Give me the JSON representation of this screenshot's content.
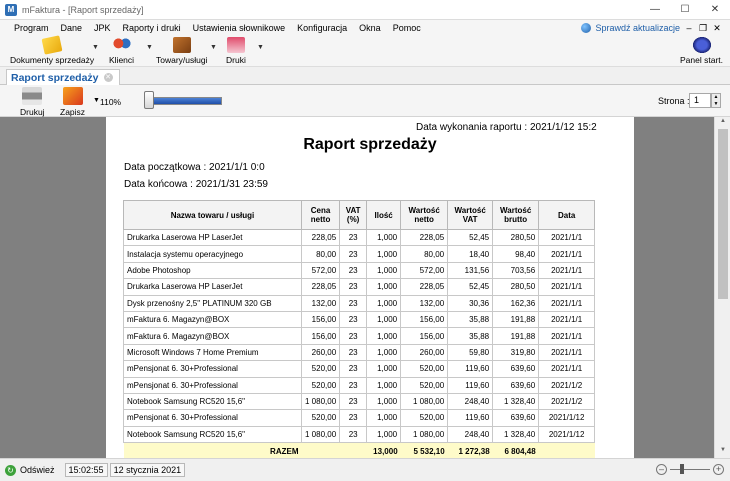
{
  "window": {
    "title": "mFaktura - [Raport sprzedaży]",
    "app_icon": "mfaktura-app-icon"
  },
  "menu": {
    "items": [
      "Program",
      "Dane",
      "JPK",
      "Raporty i druki",
      "Ustawienia słownikowe",
      "Konfiguracja",
      "Okna",
      "Pomoc"
    ],
    "update_link": "Sprawdź aktualizacje"
  },
  "toolbar": {
    "documents": "Dokumenty sprzedaży",
    "clients": "Klienci",
    "goods": "Towary/usługi",
    "prints": "Druki",
    "panel": "Panel start."
  },
  "tab": {
    "label": "Raport sprzedaży"
  },
  "report_toolbar": {
    "print": "Drukuj",
    "save": "Zapisz",
    "zoom": "110%",
    "page_label": "Strona :",
    "page_value": "1"
  },
  "report": {
    "generated": "Data wykonania raportu : 2021/1/12 15:2",
    "title": "Raport sprzedaży",
    "start_date": "Data początkowa : 2021/1/1 0:0",
    "end_date": "Data końcowa : 2021/1/31 23:59",
    "headers": [
      [
        "Nazwa towaru / usługi"
      ],
      [
        "Cena",
        "netto"
      ],
      [
        "VAT",
        "(%)"
      ],
      [
        "Ilość"
      ],
      [
        "Wartość",
        "netto"
      ],
      [
        "Wartość",
        "VAT"
      ],
      [
        "Wartość",
        "brutto"
      ],
      [
        "Data"
      ]
    ],
    "rows": [
      [
        "Drukarka Laserowa HP LaserJet",
        "228,05",
        "23",
        "1,000",
        "228,05",
        "52,45",
        "280,50",
        "2021/1/1"
      ],
      [
        "Instalacja systemu operacyjnego",
        "80,00",
        "23",
        "1,000",
        "80,00",
        "18,40",
        "98,40",
        "2021/1/1"
      ],
      [
        "Adobe Photoshop",
        "572,00",
        "23",
        "1,000",
        "572,00",
        "131,56",
        "703,56",
        "2021/1/1"
      ],
      [
        "Drukarka Laserowa HP LaserJet",
        "228,05",
        "23",
        "1,000",
        "228,05",
        "52,45",
        "280,50",
        "2021/1/1"
      ],
      [
        "Dysk przenośny 2,5\" PLATINUM 320 GB",
        "132,00",
        "23",
        "1,000",
        "132,00",
        "30,36",
        "162,36",
        "2021/1/1"
      ],
      [
        "mFaktura 6. Magazyn@BOX",
        "156,00",
        "23",
        "1,000",
        "156,00",
        "35,88",
        "191,88",
        "2021/1/1"
      ],
      [
        "mFaktura 6. Magazyn@BOX",
        "156,00",
        "23",
        "1,000",
        "156,00",
        "35,88",
        "191,88",
        "2021/1/1"
      ],
      [
        "Microsoft Windows 7 Home Premium",
        "260,00",
        "23",
        "1,000",
        "260,00",
        "59,80",
        "319,80",
        "2021/1/1"
      ],
      [
        "mPensjonat 6. 30+Professional",
        "520,00",
        "23",
        "1,000",
        "520,00",
        "119,60",
        "639,60",
        "2021/1/1"
      ],
      [
        "mPensjonat 6. 30+Professional",
        "520,00",
        "23",
        "1,000",
        "520,00",
        "119,60",
        "639,60",
        "2021/1/2"
      ],
      [
        "Notebook Samsung RC520 15,6\"",
        "1 080,00",
        "23",
        "1,000",
        "1 080,00",
        "248,40",
        "1 328,40",
        "2021/1/2"
      ],
      [
        "mPensjonat 6. 30+Professional",
        "520,00",
        "23",
        "1,000",
        "520,00",
        "119,60",
        "639,60",
        "2021/1/12"
      ],
      [
        "Notebook Samsung RC520 15,6\"",
        "1 080,00",
        "23",
        "1,000",
        "1 080,00",
        "248,40",
        "1 328,40",
        "2021/1/12"
      ]
    ],
    "summary": {
      "label": "RAZEM",
      "quantity": "13,000",
      "net": "5 532,10",
      "vat": "1 272,38",
      "gross": "6 804,48"
    }
  },
  "status": {
    "refresh": "Odśwież",
    "time": "15:02:55",
    "date": "12 stycznia 2021"
  },
  "colors": {
    "accent": "#1f5fa8",
    "summary_row": "#fefbc9",
    "document_background": "#808080"
  }
}
